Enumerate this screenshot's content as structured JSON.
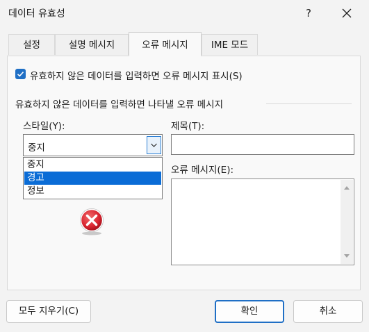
{
  "dialog": {
    "title": "데이터 유효성",
    "help_label": "?"
  },
  "tabs": [
    {
      "label": "설정"
    },
    {
      "label": "설명 메시지"
    },
    {
      "label": "오류 메시지"
    },
    {
      "label": "IME 모드"
    }
  ],
  "active_tab": 2,
  "error_tab": {
    "show_checkbox_label": "유효하지 않은 데이터를 입력하면 오류 메시지 표시(S)",
    "show_checked": true,
    "group_label": "유효하지 않은 데이터를 입력하면 나타낼 오류 메시지",
    "style_label": "스타일(Y):",
    "style_value": "중지",
    "style_options": [
      "중지",
      "경고",
      "정보"
    ],
    "style_highlighted": "경고",
    "title_label": "제목(T):",
    "title_value": "",
    "message_label": "오류 메시지(E):",
    "message_value": "",
    "style_icon": "stop-error-icon"
  },
  "buttons": {
    "clear_all": "모두 지우기(C)",
    "ok": "확인",
    "cancel": "취소"
  },
  "colors": {
    "accent": "#1f6fc5",
    "selection": "#0a6cd6",
    "stop_icon": "#d9232f"
  }
}
